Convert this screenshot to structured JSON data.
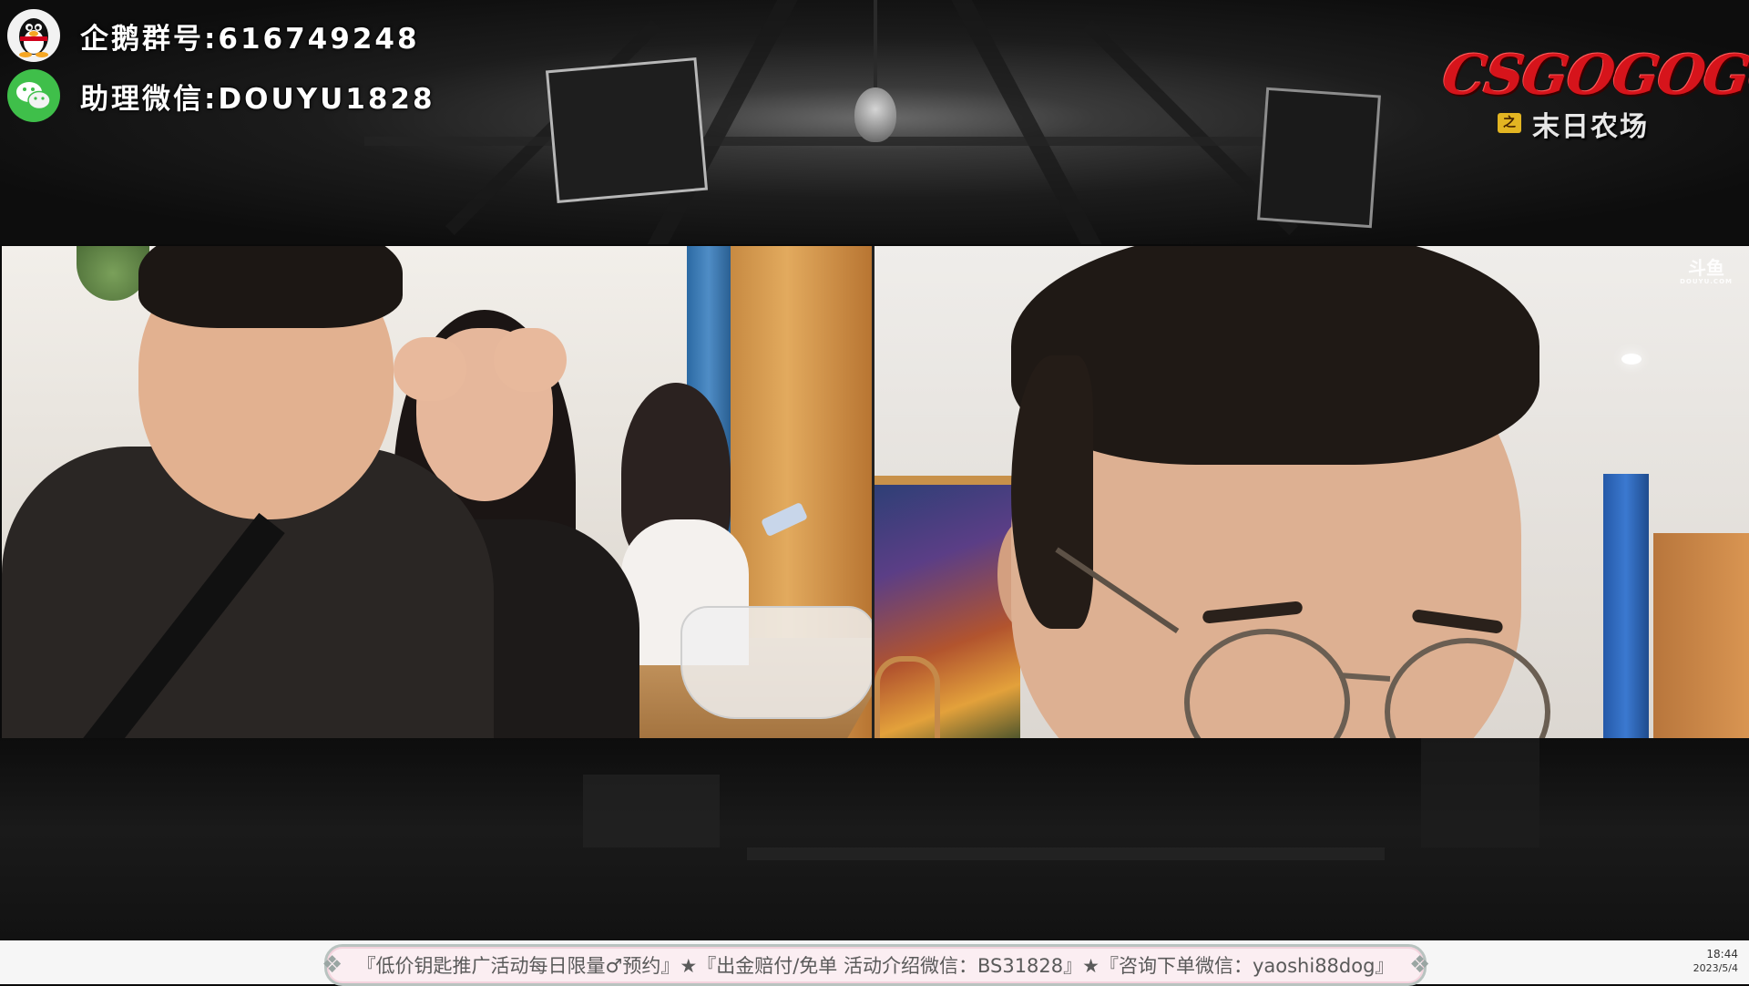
{
  "overlay": {
    "qq_group": "企鹅群号:616749248",
    "assistant_wechat": "助理微信:DOUYU1828",
    "logo_main": "CSGOGOGO",
    "logo_sub": "末日农场",
    "logo_tag": "之"
  },
  "icons": {
    "qq": "qq-penguin-icon",
    "wechat": "wechat-icon",
    "bulb": "hanging-bulb"
  },
  "right_stream": {
    "watermark": "斗鱼",
    "watermark_sub": "DOUYU.COM"
  },
  "ticker": {
    "text": "『低价钥匙推广活动每日限量♂预约』★『出金赔付/免单 活动介绍微信：BS31828』★『咨询下单微信：yaoshi88dog』"
  },
  "taskbar": {
    "time": "18:44",
    "date": "2023/5/4"
  },
  "colors": {
    "logo_red": "#d6141b",
    "wechat_green": "#3fbf4a",
    "ticker_bg": "#fbeef2"
  }
}
